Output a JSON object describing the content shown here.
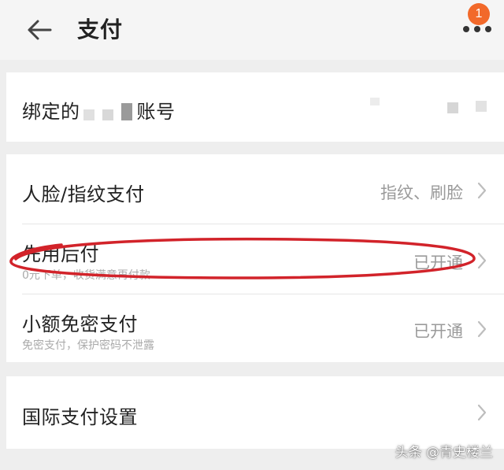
{
  "header": {
    "title": "支付",
    "back_icon": "arrow-left-icon",
    "more_icon": "more-dots-icon",
    "badge_count": "1",
    "badge_color": "#f2692a"
  },
  "account": {
    "label_prefix": "绑定的",
    "label_suffix": "账号"
  },
  "settings": {
    "face_pay": {
      "title": "人脸/指纹支付",
      "value": "指纹、刷脸"
    },
    "pay_later": {
      "title": "先用后付",
      "subtitle": "0元下单，收货满意再付款",
      "value": "已开通"
    },
    "small_pay": {
      "title": "小额免密支付",
      "subtitle": "免密支付，保护密码不泄露",
      "value": "已开通"
    },
    "intl_pay": {
      "title": "国际支付设置"
    }
  },
  "annotation": {
    "color": "#d2232a"
  },
  "watermark": "头条 @青史楼兰"
}
